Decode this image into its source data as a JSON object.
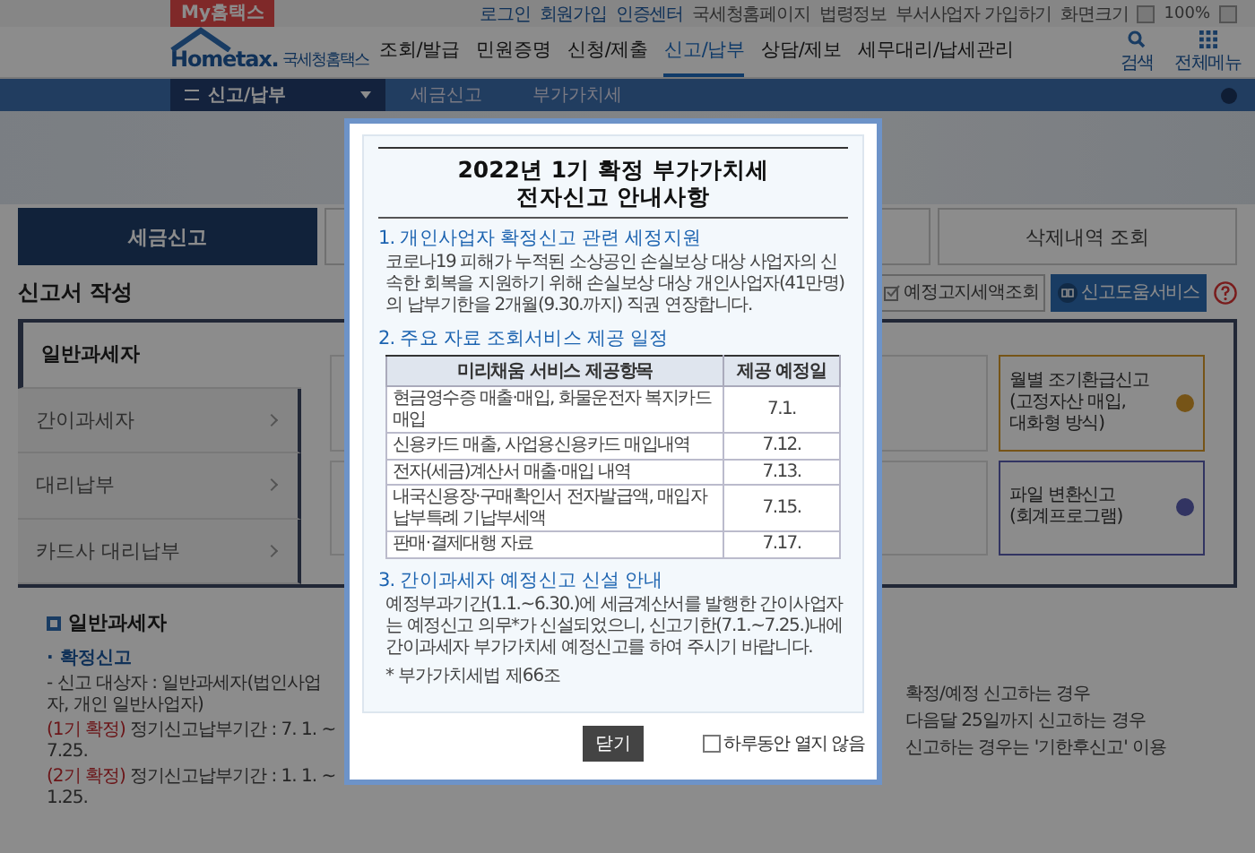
{
  "util_bar": {
    "badge": "My홈택스",
    "links": [
      "로그인",
      "회원가입",
      "인증센터",
      "국세청홈페이지",
      "법령정보",
      "부서사업자 가입하기",
      "화면크기"
    ],
    "zoom": "100%"
  },
  "header": {
    "logo": "Hometax.",
    "logo_sub": "국세청홈택스",
    "nav": [
      {
        "label": "조회/발급",
        "selected": false
      },
      {
        "label": "민원증명",
        "selected": false
      },
      {
        "label": "신청/제출",
        "selected": false
      },
      {
        "label": "신고/납부",
        "selected": true
      },
      {
        "label": "상담/제보",
        "selected": false
      },
      {
        "label": "세무대리/납세관리",
        "selected": false
      }
    ],
    "search": "검색",
    "all_menu": "전체메뉴"
  },
  "breadcrumb": {
    "menu": "신고/납부",
    "items": [
      "세금신고",
      "부가가치세"
    ]
  },
  "tabs": [
    {
      "label": "세금신고",
      "selected": true
    },
    {
      "label": "삭제내역 조회",
      "selected": false
    }
  ],
  "section_title": "신고서 작성",
  "buttons": [
    {
      "kind": "outline",
      "label": "예정고지세액조회"
    },
    {
      "kind": "primary",
      "label": "신고도움서비스"
    }
  ],
  "side_menu": [
    {
      "label": "일반과세자",
      "selected": true
    },
    {
      "label": "간이과세자",
      "selected": false
    },
    {
      "label": "대리납부",
      "selected": false
    },
    {
      "label": "카드사 대리납부",
      "selected": false
    }
  ],
  "cards": [
    {
      "kind": "refund",
      "lines": [
        "월별 조기환급신고",
        "(고정자산 매입,",
        "대화형 방식)"
      ]
    },
    {
      "kind": "file",
      "lines": [
        "파일 변환신고",
        "(회계프로그램)"
      ]
    }
  ],
  "guide": {
    "heading": "일반과세자",
    "items": [
      {
        "kind": "bullet",
        "text": "· 확정신고"
      },
      {
        "kind": "line",
        "text": "- 신고 대상자 : 일반과세자(법인사업자, 개인 일반사업자)"
      },
      {
        "kind": "line",
        "prefix": "(1기 확정)",
        "text": " 정기신고납부기간 : 7. 1. ~ 7.25."
      },
      {
        "kind": "line",
        "prefix": "(2기 확정)",
        "text": " 정기신고납부기간 : 1. 1. ~ 1.25."
      }
    ],
    "right_fragments": [
      "확정/예정 신고하는 경우",
      "다음달 25일까지 신고하는 경우",
      "신고하는 경우는 '기한후신고' 이용"
    ]
  },
  "modal": {
    "title_lines": [
      "2022년 1기 확정 부가가치세",
      "전자신고 안내사항"
    ],
    "sections": [
      {
        "kind": "text",
        "heading": "1. 개인사업자 확정신고 관련 세정지원",
        "paragraph": "코로나19 피해가 누적된 소상공인 손실보상 대상 사업자의 신속한 회복을 지원하기 위해 손실보상 대상 개인사업자(41만명)의 납부기한을 2개월(9.30.까지) 직권 연장합니다."
      },
      {
        "kind": "table",
        "heading": "2. 주요 자료 조회서비스 제공 일정",
        "columns": [
          "미리채움 서비스 제공항목",
          "제공 예정일"
        ],
        "rows": [
          [
            "현금영수증 매출·매입, 화물운전자 복지카드 매입",
            "7.1."
          ],
          [
            "신용카드 매출, 사업용신용카드 매입내역",
            "7.12."
          ],
          [
            "전자(세금)계산서 매출·매입 내역",
            "7.13."
          ],
          [
            "내국신용장·구매확인서 전자발급액, 매입자납부특례 기납부세액",
            "7.15."
          ],
          [
            "판매·결제대행 자료",
            "7.17."
          ]
        ]
      },
      {
        "kind": "text",
        "heading": "3. 간이과세자 예정신고 신설 안내",
        "paragraph": "예정부과기간(1.1.~6.30.)에 세금계산서를 발행한 간이사업자는 예정신고 의무*가 신설되었으니, 신고기한(7.1.~7.25.)내에 간이과세자 부가가치세 예정신고를 하여 주시기 바랍니다.",
        "note": "* 부가가치세법 제66조"
      }
    ],
    "close_button": "닫기",
    "dont_show": {
      "label": "하루동안 열지 않음",
      "checked": false
    }
  }
}
